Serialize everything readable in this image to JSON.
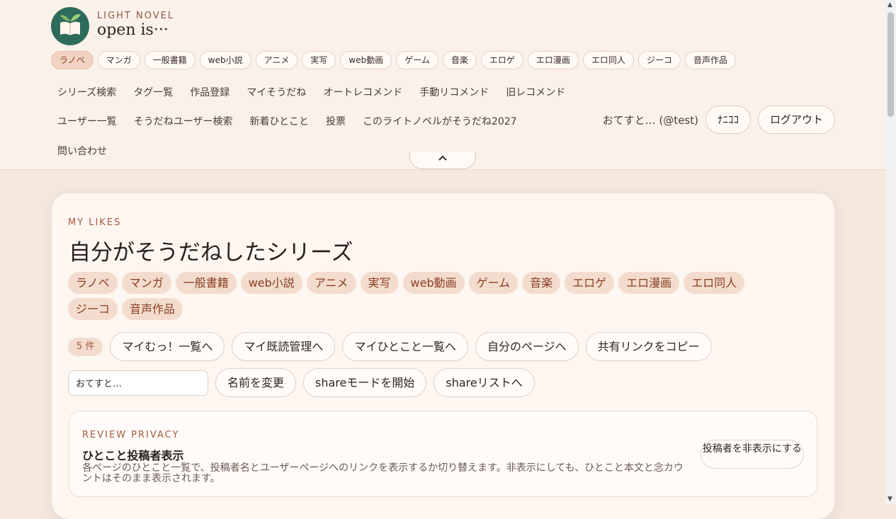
{
  "brand": {
    "small": "LIGHT NOVEL",
    "main": "open is···"
  },
  "categories": [
    "ラノベ",
    "マンガ",
    "一般書籍",
    "web小説",
    "アニメ",
    "実写",
    "web動画",
    "ゲーム",
    "音楽",
    "エロゲ",
    "エロ漫画",
    "エロ同人",
    "ジーコ",
    "音声作品"
  ],
  "nav1": [
    "シリーズ検索",
    "タグ一覧",
    "作品登録",
    "マイそうだね",
    "オートレコメンド",
    "手動リコメンド",
    "旧レコメンド"
  ],
  "nav2": [
    "ユーザー一覧",
    "そうだねユーザー検索",
    "新着ひとこと",
    "投票",
    "このライトノベルがそうだね2027"
  ],
  "nav3": [
    "問い合わせ"
  ],
  "user": {
    "name": "おてすと… (@test)",
    "nico_button": "ﾅﾆｺｺ",
    "logout_button": "ログアウト"
  },
  "collapse_icon": "chevron-up-icon",
  "page": {
    "eyebrow": "MY LIKES",
    "title": "自分がそうだねしたシリーズ",
    "filters": [
      "ラノベ",
      "マンガ",
      "一般書籍",
      "web小説",
      "アニメ",
      "実写",
      "web動画",
      "ゲーム",
      "音楽",
      "エロゲ",
      "エロ漫画",
      "エロ同人",
      "ジーコ",
      "音声作品"
    ],
    "count": "5 件",
    "actions": [
      "マイむっ！一覧へ",
      "マイ既読管理へ",
      "マイひとこと一覧へ",
      "自分のページへ",
      "共有リンクをコピー"
    ],
    "name_input_value": "おてすと…",
    "actions2": [
      "名前を変更",
      "shareモードを開始",
      "shareリストへ"
    ]
  },
  "privacy": {
    "eyebrow": "REVIEW PRIVACY",
    "title": "ひとこと投稿者表示",
    "description": "各ページのひとこと一覧で、投稿者名とユーザーページへのリンクを表示するか切り替えます。非表示にしても、ひとこと本文と念カウントはそのまま表示されます。",
    "button": "投稿者を非表示にする"
  },
  "colors": {
    "background": "#f4e8df",
    "header": "#faf1ea",
    "accent": "#a45a3e",
    "tag_bg": "#f3dccd",
    "logo_green": "#2e6b5a"
  }
}
